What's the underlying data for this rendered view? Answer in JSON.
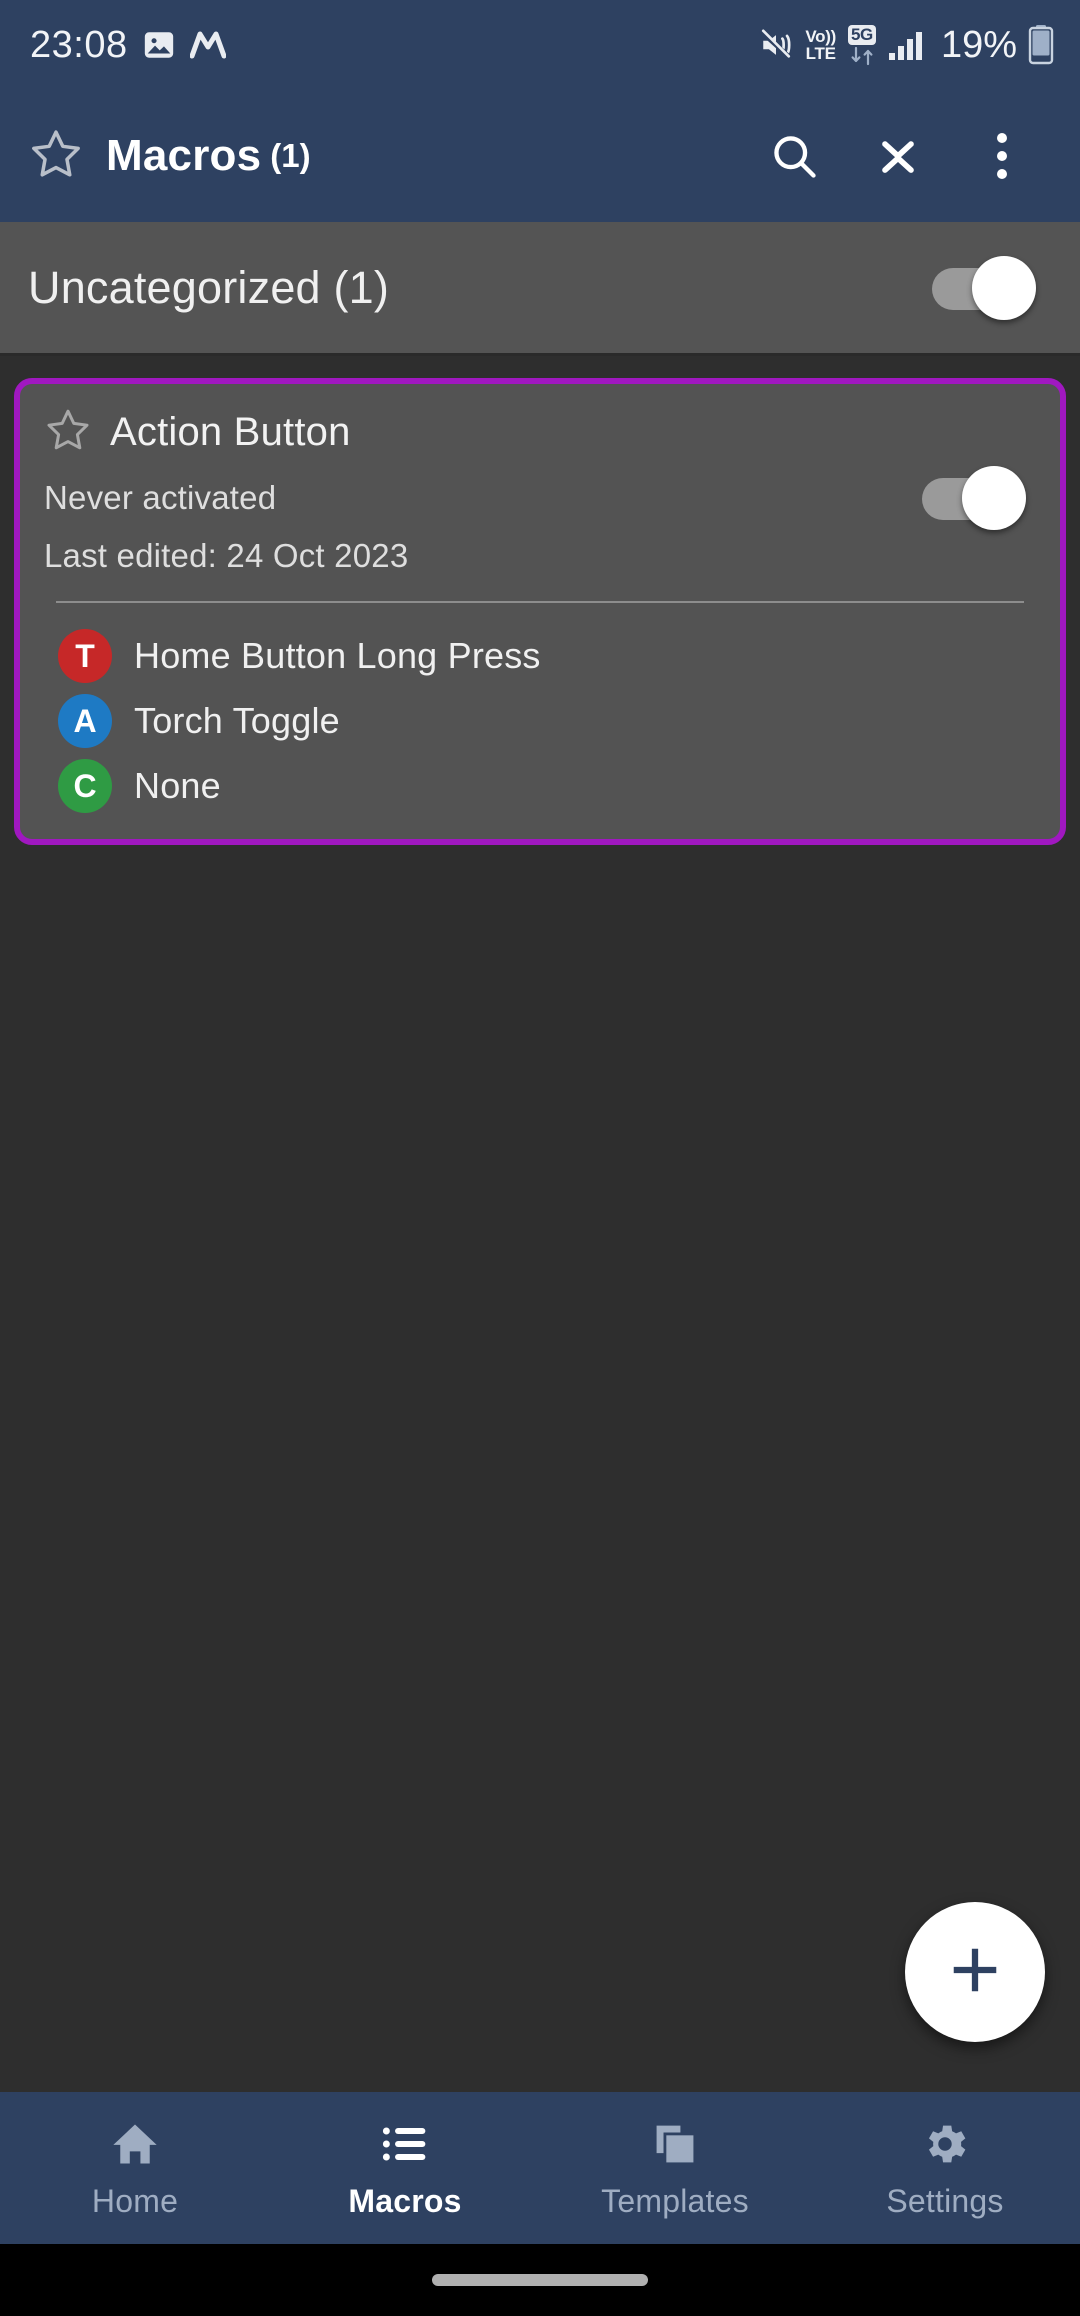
{
  "status_bar": {
    "time": "23:08",
    "icons": [
      "image-icon",
      "monzo-app-icon",
      "mute-icon",
      "volte-icon",
      "5g-data-icon",
      "signal-bars-icon",
      "battery-icon"
    ],
    "volte_top": "Vo))",
    "volte_bottom": "LTE",
    "network_badge": "5G",
    "battery_percent": "19%"
  },
  "toolbar": {
    "title": "Macros",
    "count": "(1)",
    "favorite_icon": "star-outline-icon",
    "search_icon": "search-icon",
    "collapse_icon": "collapse-all-icon",
    "overflow_icon": "more-vertical-icon"
  },
  "category": {
    "title": "Uncategorized (1)",
    "enabled": true
  },
  "macro": {
    "title": "Action Button",
    "favorite_icon": "star-outline-icon",
    "activation_status": "Never activated",
    "last_edited": "Last edited: 24 Oct 2023",
    "enabled": true,
    "border_color": "#a018c0",
    "items": [
      {
        "badge": "T",
        "badge_color": "#c62828",
        "label": "Home Button Long Press"
      },
      {
        "badge": "A",
        "badge_color": "#1e7ac4",
        "label": "Torch Toggle"
      },
      {
        "badge": "C",
        "badge_color": "#2f9b44",
        "label": "None"
      }
    ]
  },
  "fab": {
    "icon": "plus-icon",
    "label": "+"
  },
  "bottom_nav": {
    "items": [
      {
        "label": "Home",
        "icon": "home-icon",
        "active": false
      },
      {
        "label": "Macros",
        "icon": "list-icon",
        "active": true
      },
      {
        "label": "Templates",
        "icon": "copy-icon",
        "active": false
      },
      {
        "label": "Settings",
        "icon": "gear-icon",
        "active": false
      }
    ]
  },
  "colors": {
    "chrome_blue": "#2e4161",
    "background": "#2e2e2e",
    "card": "#535353",
    "category_band": "#545454",
    "accent_purple": "#a018c0"
  }
}
